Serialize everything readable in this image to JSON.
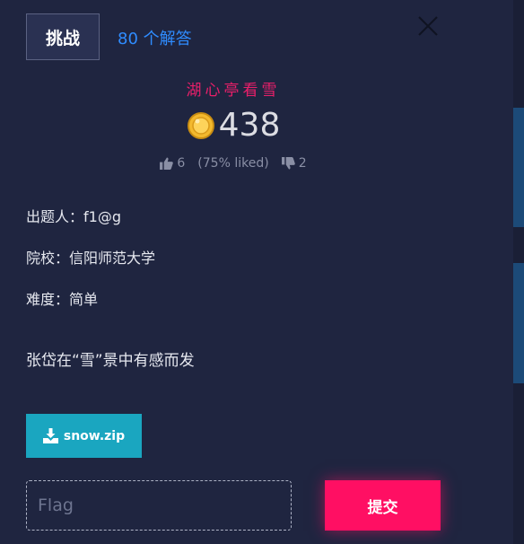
{
  "header": {
    "tab_label": "挑战",
    "solves_label": "80 个解答"
  },
  "challenge": {
    "title": "湖心亭看雪",
    "points": "438",
    "likes": {
      "up": "6",
      "percent": "(75% liked)",
      "down": "2"
    },
    "author": "出题人：f1@g",
    "school": "院校：信阳师范大学",
    "difficulty": "难度：简单",
    "description": "张岱在“雪”景中有感而发",
    "attachment": "snow.zip"
  },
  "form": {
    "flag_placeholder": "Flag",
    "submit_label": "提交"
  },
  "colors": {
    "background": "#1f2540",
    "accent_pink": "#ff0f63",
    "title_pink": "#ea1f6a",
    "link_blue": "#2f8cff",
    "download_teal": "#1aa6c0"
  },
  "icons": [
    "close-icon",
    "coin-icon",
    "thumbs-up-icon",
    "thumbs-down-icon",
    "download-icon"
  ]
}
